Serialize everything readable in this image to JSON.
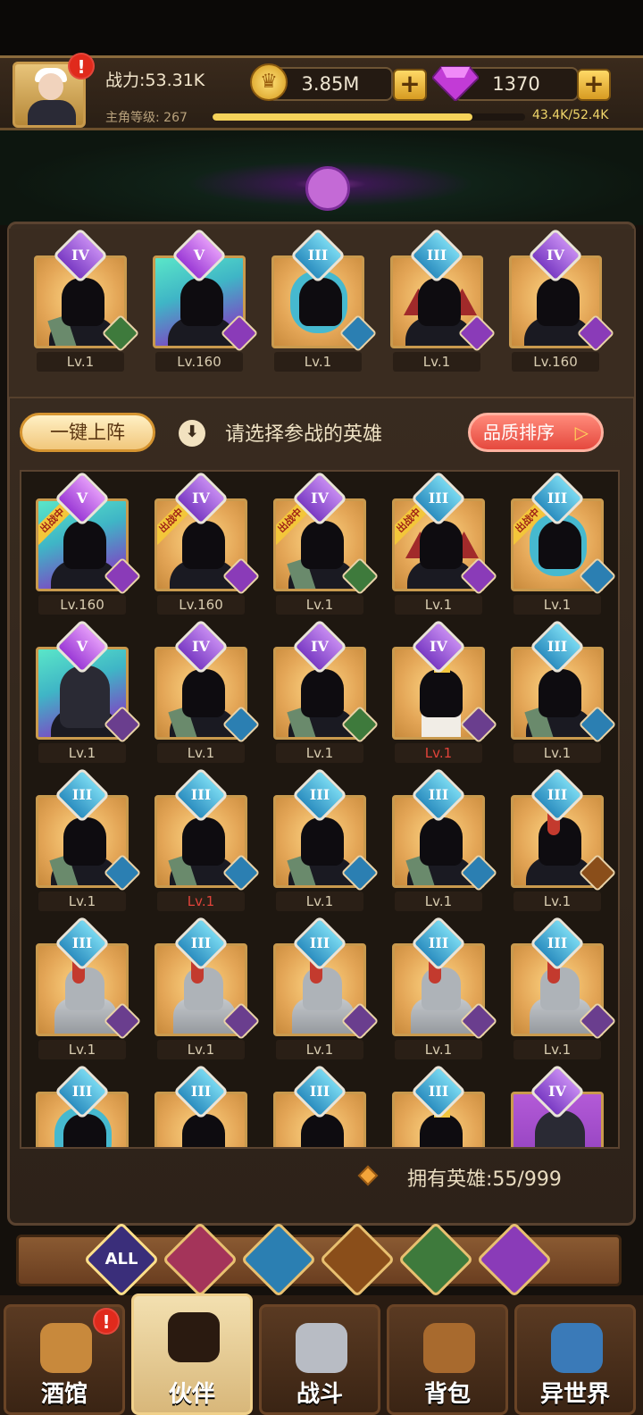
{
  "hud": {
    "power": "战力:53.31K",
    "level_label": "主角等级:",
    "level": "267",
    "xp_text": "43.4K/52.4K",
    "xp_fraction": 0.83,
    "gold": "3.85M",
    "gems": "1370",
    "alert": "!"
  },
  "team": [
    {
      "tier": "IV",
      "level": "Lv.1",
      "faction": "elf",
      "art": "elf"
    },
    {
      "tier": "V",
      "level": "Lv.160",
      "faction": "monster",
      "art": "purple-brute"
    },
    {
      "tier": "III",
      "level": "Lv.1",
      "faction": "ocean",
      "art": "bluehair"
    },
    {
      "tier": "III",
      "level": "Lv.1",
      "faction": "monster",
      "art": "demon"
    },
    {
      "tier": "IV",
      "level": "Lv.160",
      "faction": "monster",
      "art": "purple-ogre"
    }
  ],
  "actions": {
    "auto_deploy": "一键上阵",
    "hint_icon": "⬇",
    "hint": "请选择参战的英雄",
    "sort": "品质排序",
    "sort_arrow": "▷"
  },
  "badge_text": "出战中",
  "heroes": [
    {
      "tier": "V",
      "level": "Lv.160",
      "faction": "monster",
      "art": "purple-brute",
      "deployed": true
    },
    {
      "tier": "IV",
      "level": "Lv.160",
      "faction": "monster",
      "art": "purple-ogre",
      "deployed": true
    },
    {
      "tier": "IV",
      "level": "Lv.1",
      "faction": "elf",
      "art": "elf",
      "deployed": true
    },
    {
      "tier": "III",
      "level": "Lv.1",
      "faction": "monster",
      "art": "demon",
      "deployed": true
    },
    {
      "tier": "III",
      "level": "Lv.1",
      "faction": "ocean",
      "art": "bluehair",
      "deployed": true
    },
    {
      "tier": "V",
      "level": "Lv.1",
      "faction": "human",
      "art": "hood",
      "deployed": false
    },
    {
      "tier": "IV",
      "level": "Lv.1",
      "faction": "ocean",
      "art": "shadow",
      "deployed": false
    },
    {
      "tier": "IV",
      "level": "Lv.1",
      "faction": "elf",
      "art": "elf",
      "deployed": false
    },
    {
      "tier": "IV",
      "level": "Lv.1",
      "faction": "human",
      "art": "priest",
      "deployed": false,
      "red": true
    },
    {
      "tier": "III",
      "level": "Lv.1",
      "faction": "ocean",
      "art": "shadow",
      "deployed": false
    },
    {
      "tier": "III",
      "level": "Lv.1",
      "faction": "ocean",
      "art": "shadow",
      "deployed": false
    },
    {
      "tier": "III",
      "level": "Lv.1",
      "faction": "ocean",
      "art": "shadow",
      "deployed": false,
      "red": true
    },
    {
      "tier": "III",
      "level": "Lv.1",
      "faction": "ocean",
      "art": "shadow",
      "deployed": false
    },
    {
      "tier": "III",
      "level": "Lv.1",
      "faction": "ocean",
      "art": "shadow",
      "deployed": false
    },
    {
      "tier": "III",
      "level": "Lv.1",
      "faction": "beast",
      "art": "redshadow",
      "deployed": false
    },
    {
      "tier": "III",
      "level": "Lv.1",
      "faction": "human",
      "art": "knight",
      "deployed": false
    },
    {
      "tier": "III",
      "level": "Lv.1",
      "faction": "human",
      "art": "knight",
      "deployed": false
    },
    {
      "tier": "III",
      "level": "Lv.1",
      "faction": "human",
      "art": "knight",
      "deployed": false
    },
    {
      "tier": "III",
      "level": "Lv.1",
      "faction": "human",
      "art": "knight",
      "deployed": false
    },
    {
      "tier": "III",
      "level": "Lv.1",
      "faction": "human",
      "art": "knight",
      "deployed": false
    },
    {
      "tier": "III",
      "level": "",
      "faction": "",
      "art": "bluehair",
      "deployed": false
    },
    {
      "tier": "III",
      "level": "",
      "faction": "",
      "art": "elf",
      "deployed": false
    },
    {
      "tier": "III",
      "level": "",
      "faction": "",
      "art": "elf",
      "deployed": false
    },
    {
      "tier": "III",
      "level": "",
      "faction": "",
      "art": "priest",
      "deployed": false
    },
    {
      "tier": "IV",
      "level": "",
      "faction": "",
      "art": "purple-card",
      "deployed": false
    }
  ],
  "owned": {
    "label": "拥有英雄:",
    "count": "55/999"
  },
  "filters": [
    {
      "label": "ALL",
      "icon": "all-icon"
    },
    {
      "label": "",
      "icon": "human-faction-icon"
    },
    {
      "label": "",
      "icon": "ocean-faction-icon"
    },
    {
      "label": "",
      "icon": "beast-faction-icon"
    },
    {
      "label": "",
      "icon": "elf-faction-icon"
    },
    {
      "label": "",
      "icon": "monster-faction-icon"
    }
  ],
  "nav": [
    {
      "label": "酒馆",
      "icon": "tavern-icon",
      "alert": true
    },
    {
      "label": "伙伴",
      "icon": "partner-icon",
      "active": true
    },
    {
      "label": "战斗",
      "icon": "battle-icon"
    },
    {
      "label": "背包",
      "icon": "backpack-icon"
    },
    {
      "label": "异世界",
      "icon": "otherworld-icon"
    }
  ],
  "colors": {
    "gold": "#f6d35a",
    "red_level": "#e0433a",
    "panel": "#3a2c20"
  }
}
